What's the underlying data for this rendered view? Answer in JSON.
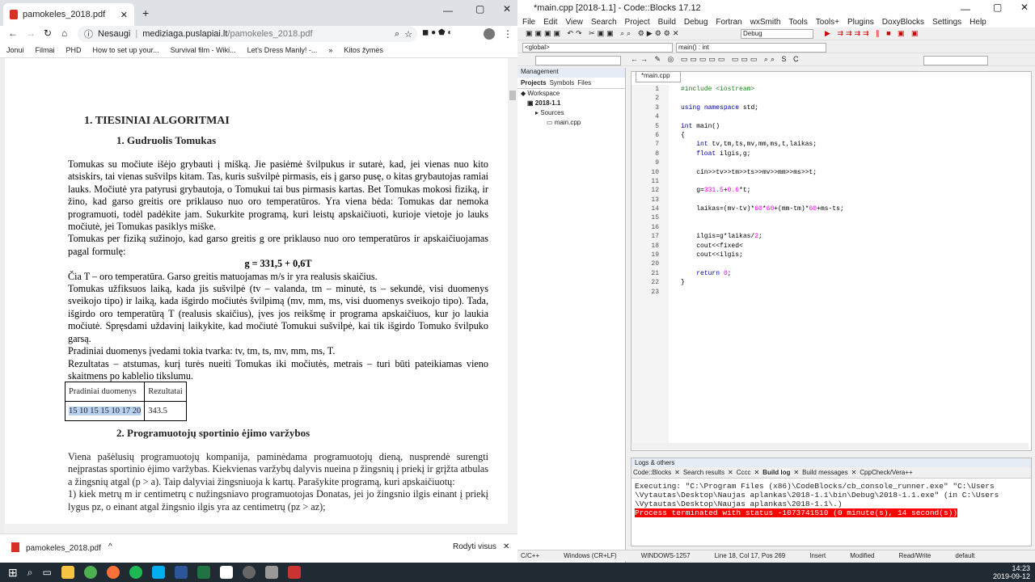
{
  "browser": {
    "tab_title": "pamokeles_2018.pdf",
    "url_security": "Nesaugi",
    "url_host": "mediziaga.puslapiai.lt",
    "url_path": "/pamokeles_2018.pdf",
    "bookmarks": [
      "Jonui",
      "Filmai",
      "PHD",
      "How to set up your...",
      "Survival film - Wiki...",
      "Let's Dress Manly! -..."
    ],
    "bookmarks_more": "Kitos žymės",
    "download_file": "pamokeles_2018.pdf",
    "download_show_all": "Rodyti visus"
  },
  "pdf": {
    "heading1": "1.  TIESINIAI ALGORITMAI",
    "heading1_1": "1.   Gudruolis Tomukas",
    "p1": "Tomukas su močiute išėjo grybauti į mišką. Jie pasiėmė švilpukus ir sutarė, kad, jei vienas nuo kito atsiskirs, tai vienas sušvilps kitam. Tas, kuris sušvilpė pirmasis, eis į garso pusę, o kitas grybautojas ramiai lauks. Močiutė yra patyrusi grybautoja, o Tomukui tai bus pirmasis kartas. Bet Tomukas mokosi fiziką, ir žino, kad garso greitis ore priklauso nuo oro temperatūros. Yra viena bėda: Tomukas dar nemoka programuoti, todėl padėkite jam. Sukurkite programą, kuri leistų apskaičiuoti, kurioje vietoje jo lauks močiutė, jei Tomukas pasiklys miške.",
    "p2": "Tomukas per fiziką sužinojo, kad garso greitis g ore priklauso nuo oro temperatūros ir apskaičiuojamas pagal formulę:",
    "formula": "g = 331,5 + 0,6T",
    "p3": "Čia T – oro temperatūra. Garso greitis matuojamas m/s ir yra realusis skaičius.",
    "p4": "Tomukas užfiksuos laiką, kada jis sušvilpė (tv – valanda, tm – minutė, ts – sekundė, visi duomenys sveikojo tipo) ir laiką, kada išgirdo močiutės švilpimą (mv, mm, ms, visi duomenys sveikojo tipo). Tada, išgirdo oro temperatūrą T (realusis skaičius), įves jos reikšmę ir programa apskaičiuos, kur jo laukia močiutė. Spręsdami uždavinį laikykite, kad močiutė Tomukui sušvilpė, kai tik išgirdo Tomuko švilpuko garsą.",
    "p5": "Pradiniai duomenys įvedami tokia tvarka: tv, tm, ts, mv, mm, ms, T.",
    "p6": "Rezultatas – atstumas, kurį turės nueiti Tomukas iki močiutės, metrais – turi būti pateikiamas vieno skaitmens po kablelio tikslumu.",
    "table_head": [
      "Pradiniai duomenys",
      "Rezultatai"
    ],
    "table_row": [
      "15 10 15 15 10 17 20",
      "343.5"
    ],
    "heading2": "2.   Programuotojų sportinio ėjimo varžybos",
    "p7": "Viena pašėlusių programuotojų kompanija, paminėdama programuotojų dieną, nusprendė surengti neįprastas sportinio ėjimo varžybas. Kiekvienas varžybų dalyvis nueina p žingsnių į priekį ir grįžta atbulas a žingsnių atgal (p > a). Taip dalyviai žingsniuoja k kartų. Parašykite programą, kuri apskaičiuotų:",
    "p8": "1) kiek metrų m ir centimetrų c nužingsniavo programuotojas Donatas, jei jo žingsnio ilgis einant į priekį lygus pz, o einant atgal žingsnio ilgis yra az centimetrų (pz > az);"
  },
  "codeblocks": {
    "title": "*main.cpp [2018-1.1] - Code::Blocks 17.12",
    "menu": [
      "File",
      "Edit",
      "View",
      "Search",
      "Project",
      "Build",
      "Debug",
      "Fortran",
      "wxSmith",
      "Tools",
      "Tools+",
      "Plugins",
      "DoxyBlocks",
      "Settings",
      "Help"
    ],
    "build_target": "Debug",
    "scope": "<global>",
    "function": "main() : int",
    "management_title": "Management",
    "management_tabs": [
      "Projects",
      "Symbols",
      "Files"
    ],
    "tree": [
      "Workspace",
      "2018-1.1",
      "Sources",
      "main.cpp"
    ],
    "editor_tab": "*main.cpp",
    "code_lines": [
      "#include <iostream>",
      "",
      "using namespace std;",
      "",
      "int main()",
      "{",
      "    int tv,tm,ts,mv,mm,ms,t,laikas;",
      "    float ilgis,g;",
      "",
      "    cin>>tv>>tm>>ts>>mv>>mm>>ms>>t;",
      "",
      "    g=331.5+0.6*t;",
      "",
      "    laikas=(mv-tv)*60*60+(mm-tm)*60+ms-ts;",
      "",
      "",
      "    ilgis=g*laikas/2;",
      "    cout<<fixed<",
      "    cout<<ilgis;",
      "",
      "    return 0;",
      "}",
      ""
    ],
    "logs_title": "Logs & others",
    "log_tabs": [
      "Code::Blocks",
      "Search results",
      "Cccc",
      "Build log",
      "Build messages",
      "CppCheck/Vera++"
    ],
    "log_lines": [
      "Executing: \"C:\\Program Files (x86)\\CodeBlocks/cb_console_runner.exe\" \"C:\\Users",
      "\\Vytautas\\Desktop\\Naujas aplankas\\2018-1.1\\bin\\Debug\\2018-1.1.exe\"  (in C:\\Users",
      "\\Vytautas\\Desktop\\Naujas aplankas\\2018-1.1\\.)"
    ],
    "log_error": "Process terminated with status -1073741510 (0 minute(s), 14 second(s))",
    "status": [
      "C/C++",
      "Windows (CR+LF)",
      "WINDOWS-1257",
      "Line 18, Col 17, Pos 269",
      "Insert",
      "Modified",
      "Read/Write",
      "default"
    ]
  },
  "taskbar": {
    "time": "14:23",
    "date": "2019-09-12"
  }
}
